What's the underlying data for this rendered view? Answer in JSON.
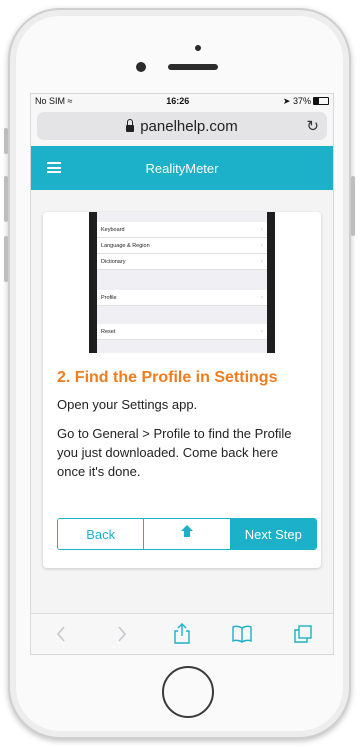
{
  "status_bar": {
    "carrier": "No SIM",
    "time": "16:26",
    "battery": "37%"
  },
  "browser": {
    "url": "panelhelp.com"
  },
  "app": {
    "title": "RealityMeter"
  },
  "step": {
    "image_menu": [
      "Keyboard",
      "Language & Region",
      "Dictionary",
      "Profile",
      "Reset"
    ],
    "title": "2. Find the Profile in Settings",
    "intro": "Open your Settings app.",
    "body": "Go to General > Profile to find the Profile you just downloaded. Come back here once it's done."
  },
  "nav": {
    "back": "Back",
    "next": "Next Step"
  },
  "colors": {
    "accent": "#1cb1c9",
    "title": "#f07c1e"
  },
  "icons": {
    "menu": "hamburger-icon",
    "home": "home-icon",
    "reload": "reload-icon",
    "lock": "lock-icon",
    "share": "share-icon",
    "bookmarks": "bookmarks-icon",
    "tabs": "tabs-icon",
    "back": "back-arrow-icon",
    "forward": "forward-arrow-icon"
  }
}
